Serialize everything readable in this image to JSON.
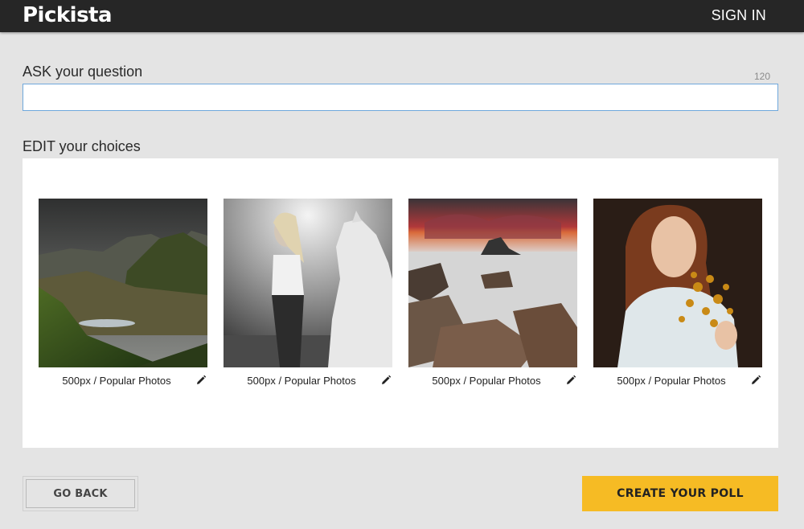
{
  "header": {
    "logo_text": "Pickista",
    "signin_label": "SIGN IN"
  },
  "question": {
    "label": "ASK your question",
    "char_limit": "120",
    "value": "",
    "placeholder": ""
  },
  "choices": {
    "label": "EDIT your choices",
    "items": [
      {
        "source": "500px",
        "separator": "/",
        "category": "Popular Photos",
        "caption": "500px / Popular Photos",
        "image": "mountain-valley-landscape-icon"
      },
      {
        "source": "500px",
        "separator": "/",
        "category": "Popular Photos",
        "caption": "500px / Popular Photos",
        "image": "woman-with-white-horse-icon"
      },
      {
        "source": "500px",
        "separator": "/",
        "category": "Popular Photos",
        "caption": "500px / Popular Photos",
        "image": "rocky-seascape-sunset-icon"
      },
      {
        "source": "500px",
        "separator": "/",
        "category": "Popular Photos",
        "caption": "500px / Popular Photos",
        "image": "woman-with-flowers-icon"
      }
    ]
  },
  "actions": {
    "back_label": "GO BACK",
    "create_label": "CREATE YOUR POLL"
  },
  "colors": {
    "accent": "#f6bb24",
    "topbar": "#262626",
    "background": "#e4e4e4",
    "input_border": "#6fa8dc"
  }
}
